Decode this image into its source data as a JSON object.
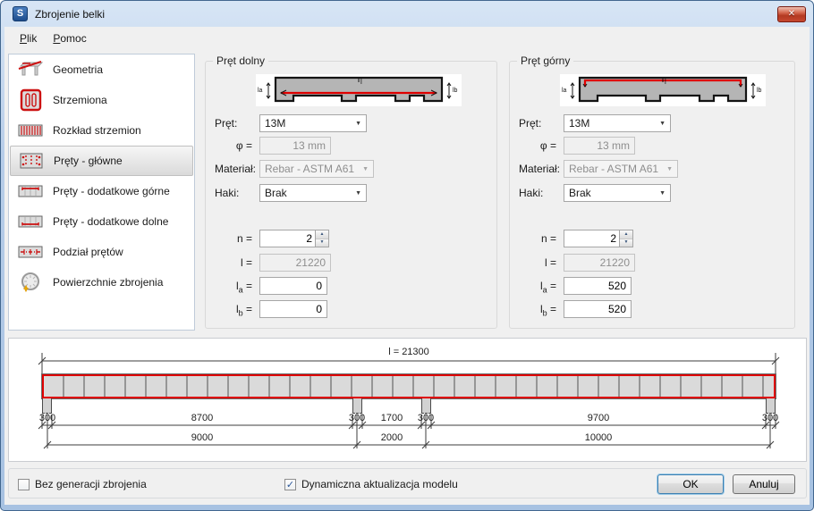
{
  "colors": {
    "rebar_red": "#df0000",
    "frame_blue": "#a7c2e2",
    "selection_gray": "#dadada",
    "check_blue": "#2b579a",
    "disabled_text": "#8e8e8e",
    "close_button_red": "#b33a22"
  },
  "icons": {
    "close": "✕",
    "dropdown_arrow": "▼",
    "spin_up": "▲",
    "spin_down": "▼",
    "check": "✓"
  },
  "window": {
    "title": "Zbrojenie belki",
    "app_icon_letter": "S"
  },
  "menu": {
    "items": [
      {
        "accel": "P",
        "rest": "lik"
      },
      {
        "accel": "P",
        "rest": "omoc"
      }
    ]
  },
  "sidebar": {
    "items": [
      {
        "label": "Geometria",
        "selected": false
      },
      {
        "label": "Strzemiona",
        "selected": false
      },
      {
        "label": "Rozkład strzemion",
        "selected": false
      },
      {
        "label": "Pręty - główne",
        "selected": true
      },
      {
        "label": "Pręty - dodatkowe górne",
        "selected": false
      },
      {
        "label": "Pręty - dodatkowe dolne",
        "selected": false
      },
      {
        "label": "Podział prętów",
        "selected": false
      },
      {
        "label": "Powierzchnie zbrojenia",
        "selected": false
      }
    ]
  },
  "pret_dolny": {
    "title": "Pręt dolny",
    "diagram": {
      "la_label": "la",
      "lb_label": "lb",
      "center_label": "l"
    },
    "rows": {
      "pret": {
        "label": "Pręt:",
        "value": "13M"
      },
      "phi": {
        "label": "φ =",
        "value": "13 mm"
      },
      "material": {
        "label": "Materiał:",
        "value": "Rebar - ASTM A61"
      },
      "haki": {
        "label": "Haki:",
        "value": "Brak"
      },
      "n": {
        "label": "n =",
        "value": "2"
      },
      "l": {
        "label": "l =",
        "value": "21220"
      },
      "la": {
        "base": "l",
        "sub": "a",
        "eq": "=",
        "value": "0"
      },
      "lb": {
        "base": "l",
        "sub": "b",
        "eq": "=",
        "value": "0"
      }
    }
  },
  "pret_gorny": {
    "title": "Pręt górny",
    "diagram": {
      "la_label": "la",
      "lb_label": "lb",
      "center_label": "l"
    },
    "rows": {
      "pret": {
        "label": "Pręt:",
        "value": "13M"
      },
      "phi": {
        "label": "φ =",
        "value": "13 mm"
      },
      "material": {
        "label": "Materiał:",
        "value": "Rebar - ASTM A61"
      },
      "haki": {
        "label": "Haki:",
        "value": "Brak"
      },
      "n": {
        "label": "n =",
        "value": "2"
      },
      "l": {
        "label": "l =",
        "value": "21220"
      },
      "la": {
        "base": "l",
        "sub": "a",
        "eq": "=",
        "value": "520"
      },
      "lb": {
        "base": "l",
        "sub": "b",
        "eq": "=",
        "value": "520"
      }
    }
  },
  "beam_diagram": {
    "total_label": "l = 21300",
    "dims_row1": [
      "300",
      "8700",
      "300",
      "1700",
      "300",
      "9700",
      "300"
    ],
    "dims_row2": [
      "9000",
      "2000",
      "10000"
    ]
  },
  "footer": {
    "no_generation": {
      "label": "Bez generacji zbrojenia",
      "checked": false,
      "mark": ""
    },
    "dynamic_update": {
      "label": "Dynamiczna aktualizacja modelu",
      "checked": true,
      "mark": "✓"
    },
    "ok_label": "OK",
    "cancel_label": "Anuluj"
  }
}
